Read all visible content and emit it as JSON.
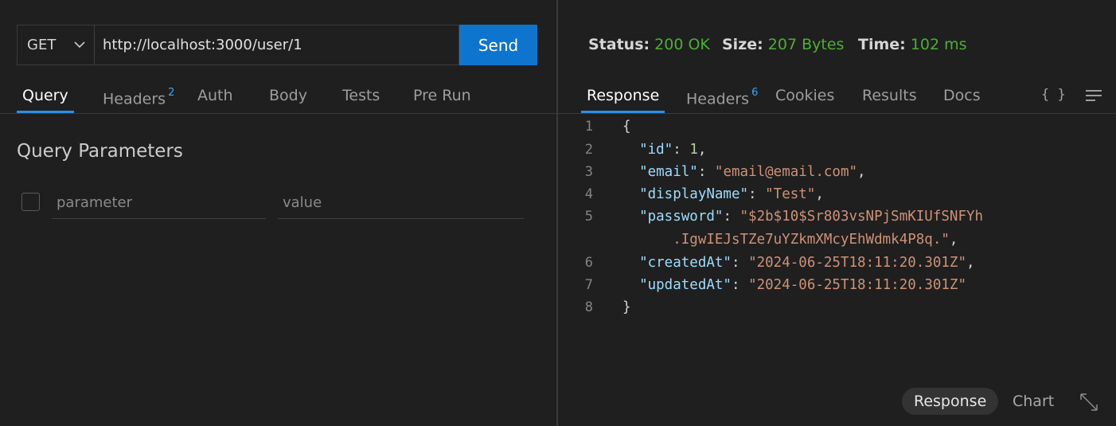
{
  "request": {
    "method": "GET",
    "url": "http://localhost:3000/user/1",
    "send_label": "Send"
  },
  "request_tabs": [
    {
      "label": "Query",
      "active": true
    },
    {
      "label": "Headers",
      "badge": "2"
    },
    {
      "label": "Auth"
    },
    {
      "label": "Body"
    },
    {
      "label": "Tests"
    },
    {
      "label": "Pre Run"
    }
  ],
  "query_params": {
    "title": "Query Parameters",
    "param_placeholder": "parameter",
    "value_placeholder": "value"
  },
  "status_bar": {
    "status_label": "Status:",
    "status_value": "200 OK",
    "size_label": "Size:",
    "size_value": "207 Bytes",
    "time_label": "Time:",
    "time_value": "102 ms",
    "value_color": "#4caf31"
  },
  "response_tabs": [
    {
      "label": "Response",
      "active": true
    },
    {
      "label": "Headers",
      "badge": "6"
    },
    {
      "label": "Cookies"
    },
    {
      "label": "Results"
    },
    {
      "label": "Docs"
    }
  ],
  "icons": {
    "format": "{ }",
    "menu": "menu-icon",
    "expand": "expand-icon",
    "chevron": "chevron-down-icon"
  },
  "response_body": {
    "line_numbers": [
      "1",
      "2",
      "3",
      "4",
      "5",
      "6",
      "7",
      "8"
    ],
    "lines": [
      {
        "parts": [
          {
            "t": "{",
            "c": "p"
          }
        ]
      },
      {
        "parts": [
          {
            "t": "  ",
            "c": "p"
          },
          {
            "t": "\"id\"",
            "c": "key"
          },
          {
            "t": ": ",
            "c": "p"
          },
          {
            "t": "1",
            "c": "num"
          },
          {
            "t": ",",
            "c": "p"
          }
        ]
      },
      {
        "parts": [
          {
            "t": "  ",
            "c": "p"
          },
          {
            "t": "\"email\"",
            "c": "key"
          },
          {
            "t": ": ",
            "c": "p"
          },
          {
            "t": "\"email@email.com\"",
            "c": "str"
          },
          {
            "t": ",",
            "c": "p"
          }
        ]
      },
      {
        "parts": [
          {
            "t": "  ",
            "c": "p"
          },
          {
            "t": "\"displayName\"",
            "c": "key"
          },
          {
            "t": ": ",
            "c": "p"
          },
          {
            "t": "\"Test\"",
            "c": "str"
          },
          {
            "t": ",",
            "c": "p"
          }
        ]
      },
      {
        "parts": [
          {
            "t": "  ",
            "c": "p"
          },
          {
            "t": "\"password\"",
            "c": "key"
          },
          {
            "t": ": ",
            "c": "p"
          },
          {
            "t": "\"$2b$10$Sr803vsNPjSmKIUfSNFYh",
            "c": "str"
          }
        ]
      },
      {
        "parts": [
          {
            "t": "      ",
            "c": "p"
          },
          {
            "t": ".IgwIEJsTZe7uYZkmXMcyEhWdmk4P8q.\"",
            "c": "str"
          },
          {
            "t": ",",
            "c": "p"
          }
        ]
      },
      {
        "parts": [
          {
            "t": "  ",
            "c": "p"
          },
          {
            "t": "\"createdAt\"",
            "c": "key"
          },
          {
            "t": ": ",
            "c": "p"
          },
          {
            "t": "\"2024-06-25T18:11:20.301Z\"",
            "c": "str"
          },
          {
            "t": ",",
            "c": "p"
          }
        ]
      },
      {
        "parts": [
          {
            "t": "  ",
            "c": "p"
          },
          {
            "t": "\"updatedAt\"",
            "c": "key"
          },
          {
            "t": ": ",
            "c": "p"
          },
          {
            "t": "\"2024-06-25T18:11:20.301Z\"",
            "c": "str"
          }
        ]
      },
      {
        "parts": [
          {
            "t": "}",
            "c": "p"
          }
        ]
      }
    ]
  },
  "bottom_tabs": [
    {
      "label": "Response",
      "active": true
    },
    {
      "label": "Chart"
    }
  ]
}
